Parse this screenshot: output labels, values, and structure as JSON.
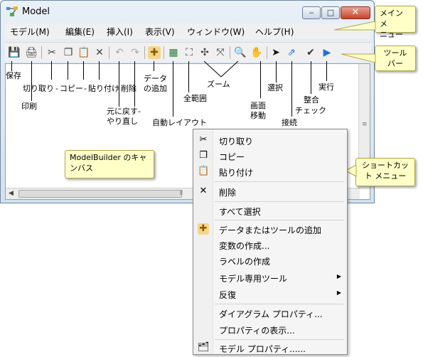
{
  "window": {
    "title": "Model",
    "minimize_glyph": "‒",
    "maximize_glyph": "□",
    "close_glyph": "✕"
  },
  "menubar": {
    "items": [
      {
        "label": "モデル(M)"
      },
      {
        "label": "編集(E)"
      },
      {
        "label": "挿入(I)"
      },
      {
        "label": "表示(V)"
      },
      {
        "label": "ウィンドウ(W)"
      },
      {
        "label": "ヘルプ(H)"
      }
    ]
  },
  "toolbar": {
    "icons": [
      {
        "name": "save-icon",
        "glyph": "💾"
      },
      {
        "name": "print-icon",
        "glyph": "🖨"
      },
      {
        "name": "cut-icon",
        "glyph": "✂"
      },
      {
        "name": "copy-icon",
        "glyph": "❐"
      },
      {
        "name": "paste-icon",
        "glyph": "📋"
      },
      {
        "name": "delete-icon",
        "glyph": "✕"
      },
      {
        "name": "undo-icon",
        "glyph": "↶"
      },
      {
        "name": "redo-icon",
        "glyph": "↷"
      },
      {
        "name": "add-data-icon",
        "glyph": "✚"
      },
      {
        "name": "auto-layout-icon",
        "glyph": "▦"
      },
      {
        "name": "full-extent-icon",
        "glyph": "⛶"
      },
      {
        "name": "zoom-in-fixed-icon",
        "glyph": "✣"
      },
      {
        "name": "zoom-out-fixed-icon",
        "glyph": "⤧"
      },
      {
        "name": "zoom-icon",
        "glyph": "🔍"
      },
      {
        "name": "pan-icon",
        "glyph": "✋"
      },
      {
        "name": "select-icon",
        "glyph": "➤"
      },
      {
        "name": "connect-icon",
        "glyph": "⇗"
      },
      {
        "name": "validate-icon",
        "glyph": "✔"
      },
      {
        "name": "run-icon",
        "glyph": "▶"
      }
    ]
  },
  "annotations": {
    "save": "保存",
    "print": "印刷",
    "cut": "切り取り",
    "copy": "コピー",
    "paste": "貼り付け",
    "delete": "削除",
    "undo_redo_line1": "元に戻す-",
    "undo_redo_line2": "やり直し",
    "add_data_line1": "データ",
    "add_data_line2": "の追加",
    "auto_layout": "自動レイアウト",
    "full_extent": "全範囲",
    "zoom": "ズーム",
    "pan_line1": "画面",
    "pan_line2": "移動",
    "select": "選択",
    "connect": "接続",
    "validate_line1": "整合",
    "validate_line2": "チェック",
    "run": "実行",
    "dash": "-"
  },
  "callouts": {
    "main_menu": "メイン メ\nニュー",
    "toolbar": "ツール\nバー",
    "canvas": "ModelBuilder のキャ\nンバス",
    "shortcut_menu": "ショートカッ\nト メニュー"
  },
  "context_menu": {
    "cut": "切り取り",
    "copy": "コピー",
    "paste": "貼り付け",
    "delete": "削除",
    "select_all": "すべて選択",
    "add_data": "データまたはツールの追加",
    "create_variable": "変数の作成...",
    "create_label": "ラベルの作成",
    "model_only_tools": "モデル専用ツール",
    "iterators": "反復",
    "diagram_properties": "ダイアグラム プロパティ...",
    "show_properties": "プロパティの表示...",
    "model_properties": "モデル プロパティ......"
  },
  "colors": {
    "callout_bg": "#ffffc8",
    "close_button": "#c7432a",
    "window_frame": "#d4e1ee"
  }
}
